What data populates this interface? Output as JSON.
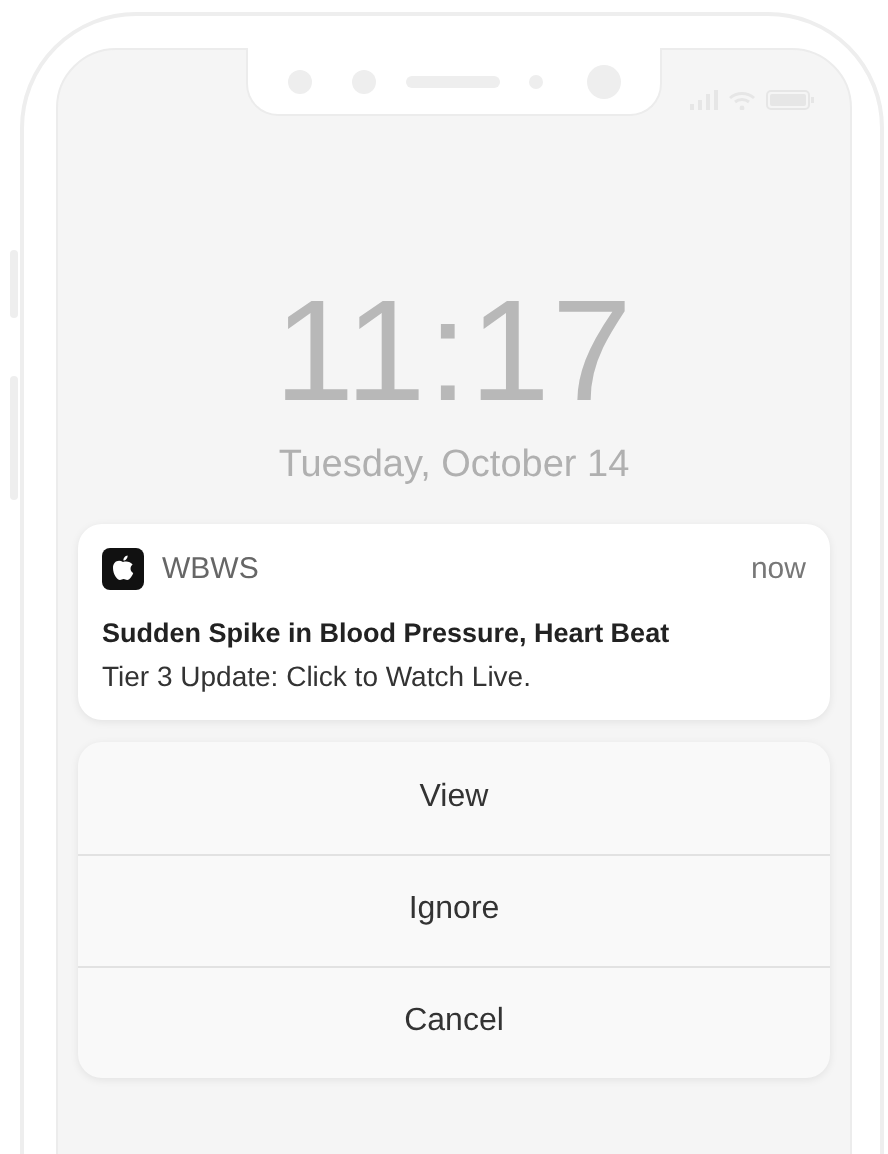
{
  "lock_screen": {
    "time": "11:17",
    "date": "Tuesday, October 14"
  },
  "notification": {
    "app": "WBWS",
    "time": "now",
    "title": "Sudden Spike in Blood Pressure, Heart Beat",
    "body": "Tier 3 Update: Click to Watch Live."
  },
  "actions": [
    {
      "label": "View"
    },
    {
      "label": "Ignore"
    },
    {
      "label": "Cancel"
    }
  ]
}
